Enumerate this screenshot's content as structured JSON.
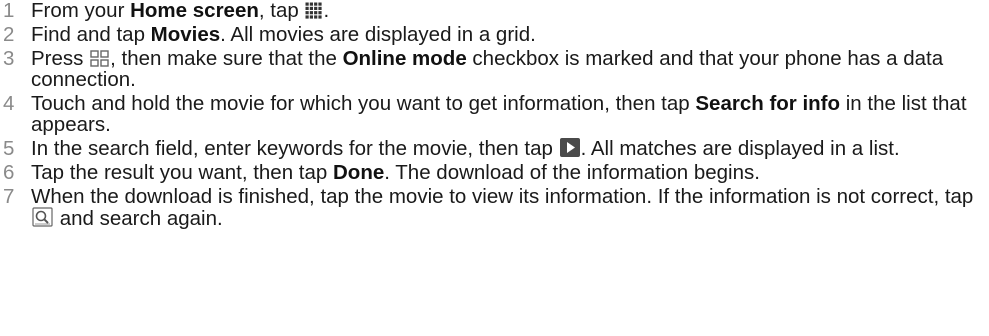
{
  "steps": [
    {
      "num": "1",
      "parts": [
        {
          "t": "text",
          "v": "From your "
        },
        {
          "t": "bold",
          "v": "Home screen"
        },
        {
          "t": "text",
          "v": ", tap "
        },
        {
          "t": "icon",
          "name": "app-grid-icon"
        },
        {
          "t": "text",
          "v": "."
        }
      ]
    },
    {
      "num": "2",
      "parts": [
        {
          "t": "text",
          "v": "Find and tap "
        },
        {
          "t": "bold",
          "v": "Movies"
        },
        {
          "t": "text",
          "v": ". All movies are displayed in a grid."
        }
      ]
    },
    {
      "num": "3",
      "parts": [
        {
          "t": "text",
          "v": "Press "
        },
        {
          "t": "icon",
          "name": "menu-icon"
        },
        {
          "t": "text",
          "v": ", then make sure that the "
        },
        {
          "t": "bold",
          "v": "Online mode"
        },
        {
          "t": "text",
          "v": " checkbox is marked and that your phone has a data connection."
        }
      ]
    },
    {
      "num": "4",
      "parts": [
        {
          "t": "text",
          "v": "Touch and hold the movie for which you want to get information, then tap "
        },
        {
          "t": "bold",
          "v": "Search for info"
        },
        {
          "t": "text",
          "v": " in the list that appears."
        }
      ]
    },
    {
      "num": "5",
      "parts": [
        {
          "t": "text",
          "v": "In the search field, enter keywords for the movie, then tap "
        },
        {
          "t": "icon",
          "name": "go-arrow-icon"
        },
        {
          "t": "text",
          "v": ". All matches are displayed in a list."
        }
      ]
    },
    {
      "num": "6",
      "parts": [
        {
          "t": "text",
          "v": "Tap the result you want, then tap "
        },
        {
          "t": "bold",
          "v": "Done"
        },
        {
          "t": "text",
          "v": ". The download of the information begins."
        }
      ]
    },
    {
      "num": "7",
      "parts": [
        {
          "t": "text",
          "v": "When the download is finished, tap the movie to view its information. If the information is not correct, tap "
        },
        {
          "t": "icon",
          "name": "search-media-icon"
        },
        {
          "t": "text",
          "v": " and search again."
        }
      ]
    }
  ],
  "colors": {
    "text": "#1a1a1a",
    "number": "#8a8a8a",
    "icon": "#555555"
  }
}
